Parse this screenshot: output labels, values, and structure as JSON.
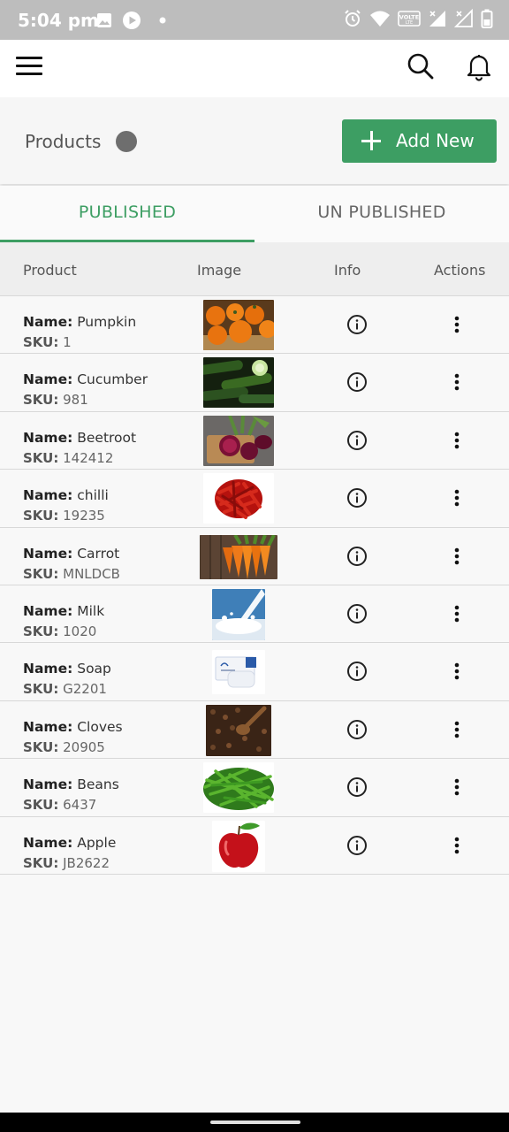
{
  "status_bar": {
    "time": "5:04 pm",
    "icons": [
      "image-icon",
      "play-icon",
      "dot-icon",
      "alarm-icon",
      "wifi-icon",
      "volte-icon",
      "signal-icon",
      "signal-2-icon",
      "battery-icon"
    ],
    "volte_label": "VOLTE"
  },
  "app_bar": {
    "icons": [
      "menu-icon",
      "search-icon",
      "bell-icon"
    ]
  },
  "header": {
    "title": "Products",
    "add_button_label": "Add New",
    "accent_color": "#3d9e63"
  },
  "tabs": [
    {
      "label": "PUBLISHED",
      "active": true
    },
    {
      "label": "UN PUBLISHED",
      "active": false
    }
  ],
  "table": {
    "columns": [
      "Product",
      "Image",
      "Info",
      "Actions"
    ],
    "name_label": "Name:",
    "sku_label": "SKU:",
    "rows": [
      {
        "name": "Pumpkin",
        "sku": "1"
      },
      {
        "name": "Cucumber",
        "sku": "981"
      },
      {
        "name": "Beetroot",
        "sku": "142412"
      },
      {
        "name": "chilli",
        "sku": "19235"
      },
      {
        "name": "Carrot",
        "sku": "MNLDCB"
      },
      {
        "name": "Milk",
        "sku": "1020"
      },
      {
        "name": "Soap",
        "sku": "G2201"
      },
      {
        "name": "Cloves",
        "sku": "20905"
      },
      {
        "name": "Beans",
        "sku": "6437"
      },
      {
        "name": "Apple",
        "sku": "JB2622"
      }
    ]
  }
}
